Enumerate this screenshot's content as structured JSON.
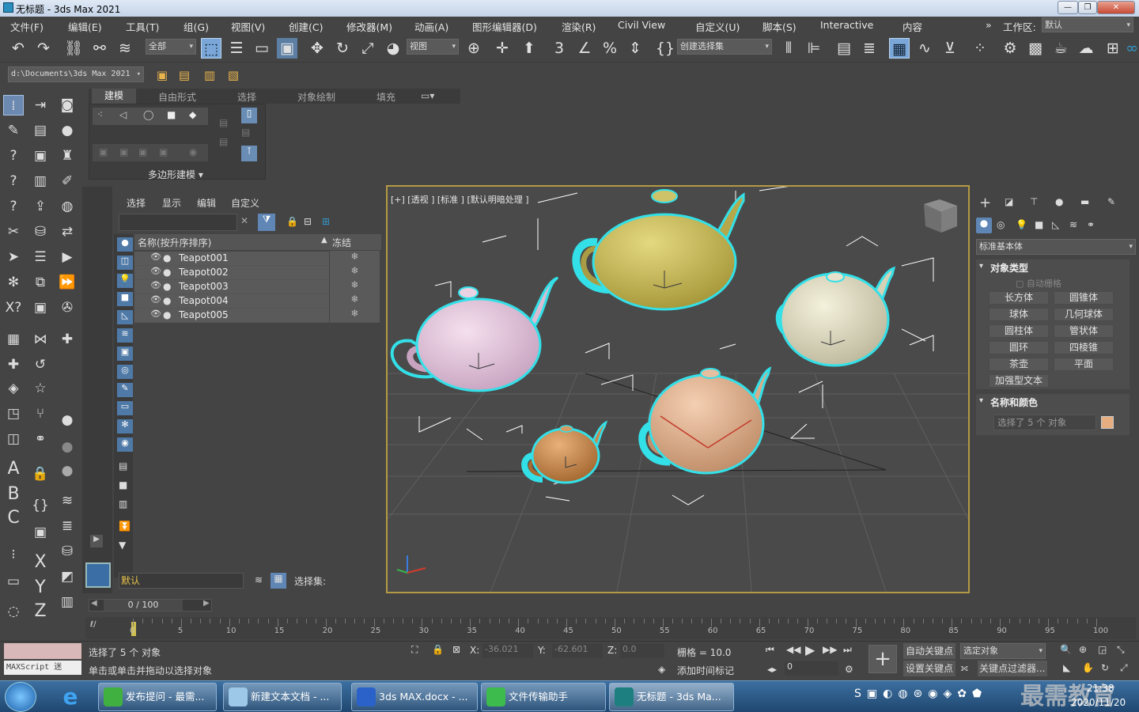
{
  "window": {
    "title": "无标题 - 3ds Max 2021"
  },
  "menu": [
    "文件(F)",
    "编辑(E)",
    "工具(T)",
    "组(G)",
    "视图(V)",
    "创建(C)",
    "修改器(M)",
    "动画(A)",
    "图形编辑器(D)",
    "渲染(R)",
    "Civil View",
    "自定义(U)",
    "脚本(S)",
    "Interactive",
    "内容"
  ],
  "workspace": {
    "label": "工作区:",
    "value": "默认"
  },
  "toolbar": {
    "filter": "全部",
    "refcoord": "视图",
    "selset": "创建选择集"
  },
  "pathbar": {
    "path": "d:\\Documents\\3ds Max 2021"
  },
  "ribbon": {
    "tabs": [
      "建模",
      "自由形式",
      "选择",
      "对象绘制",
      "填充"
    ],
    "panel": "多边形建模"
  },
  "scene_explorer": {
    "tabs": [
      "选择",
      "显示",
      "编辑",
      "自定义"
    ],
    "col_name": "名称(按升序排序)",
    "col_freeze": "冻结",
    "items": [
      "Teapot001",
      "Teapot002",
      "Teapot003",
      "Teapot004",
      "Teapot005"
    ],
    "layer": "默认",
    "selset_label": "选择集:"
  },
  "viewport": {
    "label": "[+] [透视 ] [标准 ] [默认明暗处理 ]"
  },
  "command_panel": {
    "category": "标准基本体",
    "rollout_type": "对象类型",
    "autogrid": "自动栅格",
    "buttons": [
      "长方体",
      "圆锥体",
      "球体",
      "几何球体",
      "圆柱体",
      "管状体",
      "圆环",
      "四棱锥",
      "茶壶",
      "平面",
      "加强型文本"
    ],
    "rollout_name": "名称和颜色",
    "name_value": "选择了 5 个 对象",
    "color": "#e6ae80"
  },
  "timeline": {
    "frame": "0 / 100",
    "ticks": [
      "0",
      "5",
      "10",
      "15",
      "20",
      "25",
      "30",
      "35",
      "40",
      "45",
      "50",
      "55",
      "60",
      "65",
      "70",
      "75",
      "80",
      "85",
      "90",
      "95",
      "100"
    ]
  },
  "status": {
    "maxscript": "MAXScript 迷",
    "selected": "选择了 5 个 对象",
    "prompt": "单击或单击并拖动以选择对象",
    "x_label": "X:",
    "x": "-36.021",
    "y_label": "Y:",
    "y": "-62.601",
    "z_label": "Z:",
    "z": "0.0",
    "grid": "栅格 = 10.0",
    "add_time_tag": "添加时间标记",
    "autokey": "自动关键点",
    "setkey": "设置关键点",
    "selected_obj": "选定对象",
    "key_filters": "关键点过滤器...",
    "frame_value": "0"
  },
  "taskbar": {
    "tasks": [
      "发布提问 - 最需...",
      "新建文本文档 - ...",
      "3ds MAX.docx - ...",
      "文件传输助手",
      "无标题 - 3ds Ma..."
    ],
    "time": "21:38",
    "date": "2020/11/20",
    "watermark": "最需教育"
  }
}
